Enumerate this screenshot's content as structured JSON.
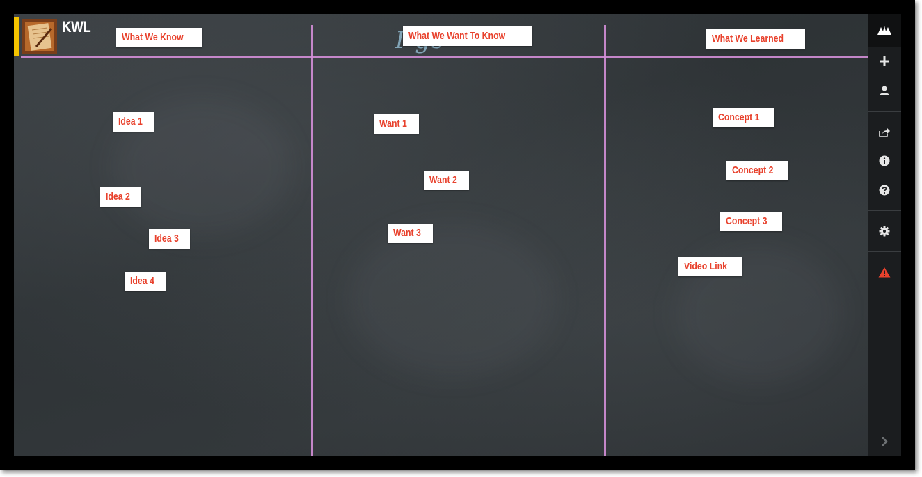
{
  "wall": {
    "title": "KWL",
    "background_text": "I      gs"
  },
  "columns": [
    {
      "header": "What We Know"
    },
    {
      "header": "What We Want To Know"
    },
    {
      "header": "What We Learned"
    }
  ],
  "notes": {
    "know": [
      "Idea 1",
      "Idea 2",
      "Idea 3",
      "Idea 4"
    ],
    "want": [
      "Want 1",
      "Want 2",
      "Want 3"
    ],
    "learned": [
      "Concept 1",
      "Concept 2",
      "Concept 3",
      "Video Link"
    ]
  },
  "sidebar": {
    "buttons": [
      {
        "icon": "padlet-logo-icon"
      },
      {
        "icon": "plus-icon"
      },
      {
        "icon": "user-icon"
      },
      {
        "icon": "share-icon"
      },
      {
        "icon": "info-icon"
      },
      {
        "icon": "help-icon"
      },
      {
        "icon": "gear-icon"
      },
      {
        "icon": "warning-icon"
      },
      {
        "icon": "chevron-right-icon"
      }
    ]
  },
  "colors": {
    "note_text": "#e8412c",
    "chalk_line": "#d48fd8",
    "accent": "#f5c400",
    "warning": "#e8412c"
  }
}
